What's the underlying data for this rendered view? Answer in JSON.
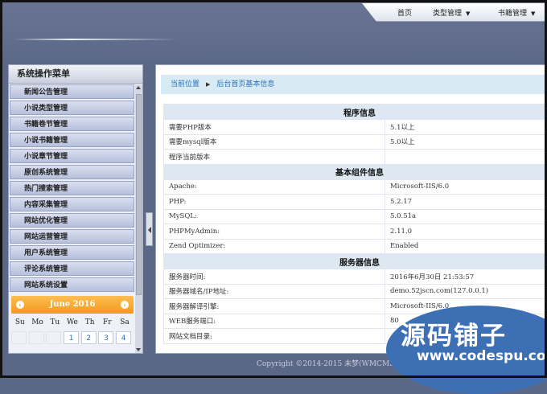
{
  "top_nav": {
    "home": "首页",
    "types": "类型管理",
    "books": "书籍管理"
  },
  "sidebar": {
    "title": "系统操作菜单",
    "items": [
      {
        "label": "新闻公告管理"
      },
      {
        "label": "小说类型管理"
      },
      {
        "label": "书籍卷节管理"
      },
      {
        "label": "小说书籍管理"
      },
      {
        "label": "小说章节管理"
      },
      {
        "label": "原创系统管理"
      },
      {
        "label": "热门搜索管理"
      },
      {
        "label": "内容采集管理"
      },
      {
        "label": "网站优化管理"
      },
      {
        "label": "网站运营管理"
      },
      {
        "label": "用户系统管理"
      },
      {
        "label": "评论系统管理"
      },
      {
        "label": "网站系统设置"
      }
    ]
  },
  "calendar": {
    "month": "June 2016",
    "days": [
      "Su",
      "Mo",
      "Tu",
      "We",
      "Th",
      "Fr",
      "Sa"
    ],
    "first_row": [
      "",
      "",
      "",
      "1",
      "2",
      "3",
      "4"
    ]
  },
  "breadcrumb": {
    "current": "当前位置",
    "page": "后台首页基本信息"
  },
  "sections": [
    {
      "title": "程序信息",
      "rows": [
        {
          "label": "需要PHP版本",
          "value": "5.1以上"
        },
        {
          "label": "需要mysql版本",
          "value": "5.0以上"
        },
        {
          "label": "程序当前版本",
          "value": ""
        }
      ]
    },
    {
      "title": "基本组件信息",
      "rows": [
        {
          "label": "Apache:",
          "value": "Microsoft-IIS/6.0"
        },
        {
          "label": "PHP:",
          "value": "5.2.17"
        },
        {
          "label": "MySQL:",
          "value": "5.0.51a"
        },
        {
          "label": "PHPMyAdmin:",
          "value": "2.11.0"
        },
        {
          "label": "Zend Optimizer:",
          "value": "Enabled"
        }
      ]
    },
    {
      "title": "服务器信息",
      "rows": [
        {
          "label": "服务器时间:",
          "value": "2016年6月30日 21:53:57"
        },
        {
          "label": "服务器域名/IP地址:",
          "value": "demo.52jscn.com(127.0.0.1)"
        },
        {
          "label": "服务器解译引擎:",
          "value": "Microsoft-IIS/6.0"
        },
        {
          "label": "WEB服务端口:",
          "value": "80"
        },
        {
          "label": "网站文档目录:",
          "value": ""
        }
      ]
    }
  ],
  "footer": "Copyright ©2014-2015 未梦(WMCMS)",
  "watermark": {
    "title": "源码铺子",
    "url": "www.codespu.com"
  },
  "colors": {
    "background": "#5a6786",
    "accent_orange": "#f09a1c",
    "link_blue": "#2a6fb8",
    "watermark_blue": "#3d6fb4"
  }
}
